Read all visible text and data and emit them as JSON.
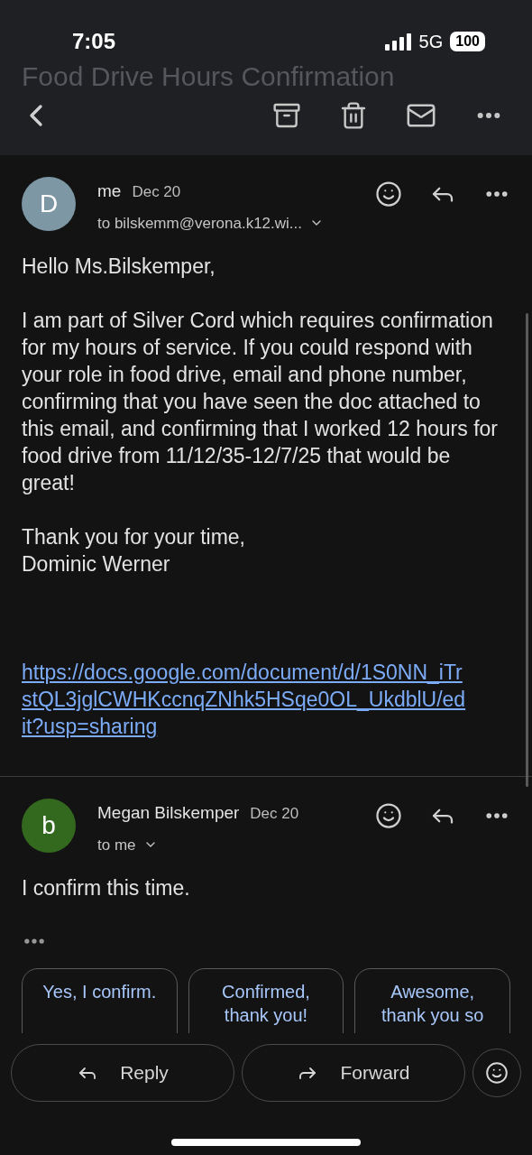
{
  "status_bar": {
    "time": "7:05",
    "network": "5G",
    "battery": "100"
  },
  "header": {
    "title": "Food Drive Hours Confirmation"
  },
  "messages": [
    {
      "avatar_letter": "D",
      "color": "#7d97a5",
      "sender": "me",
      "date": "Dec 20",
      "recipient": "to bilskemm@verona.k12.wi...",
      "paragraphs": [
        "Hello Ms.Bilskemper,",
        "I am part of Silver Cord which requires confirmation for my hours of service. If you could respond with your role in food drive, email and phone number, confirming that you have seen the doc attached to this email, and confirming that I worked 12 hours for food drive from 11/12/35-12/7/25 that would be great!",
        "Thank you for your time,\nDominic Werner"
      ],
      "link": "https://docs.google.com/document/d/1S0NN_iTrstQL3jglCWHKccnqZNhk5HSqe0OL_UkdblU/edit?usp=sharing",
      "collapsed_quote": false
    },
    {
      "avatar_letter": "b",
      "color": "#33691e",
      "sender": "Megan Bilskemper",
      "date": "Dec 20",
      "recipient": "to me",
      "paragraphs": [
        "I confirm this time."
      ],
      "collapsed_quote": true
    }
  ],
  "smart_replies": [
    "Yes, I confirm.",
    "Confirmed, thank you!",
    "Awesome, thank you so"
  ],
  "actions": [
    {
      "kind": "reply",
      "label": "Reply"
    },
    {
      "kind": "forward",
      "label": "Forward"
    }
  ]
}
